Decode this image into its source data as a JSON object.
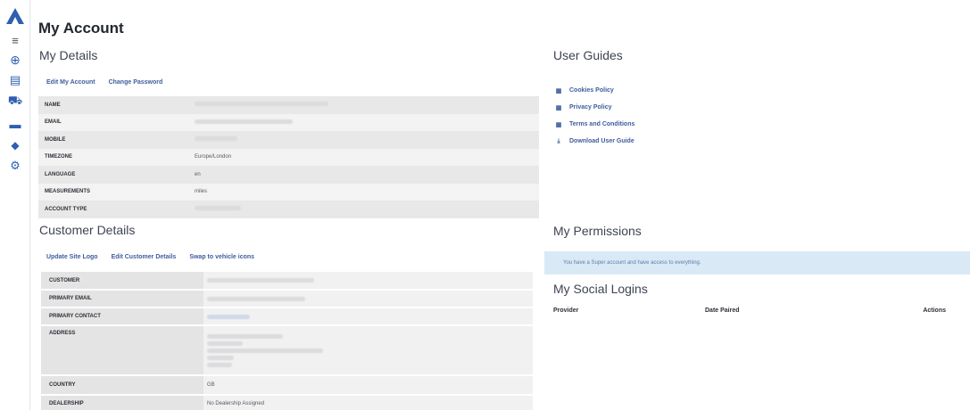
{
  "page": {
    "title": "My Account"
  },
  "sidebar": {
    "items": [
      {
        "icon": "menu-icon",
        "glyph": "≡"
      },
      {
        "icon": "globe-icon",
        "glyph": "⊕"
      },
      {
        "icon": "chart-icon",
        "glyph": "▤"
      },
      {
        "icon": "vehicle-icon",
        "glyph": "⛟"
      },
      {
        "icon": "card-icon",
        "glyph": "▬"
      },
      {
        "icon": "chat-icon",
        "glyph": "◆"
      },
      {
        "icon": "settings-icon",
        "glyph": "⚙"
      }
    ]
  },
  "my_details": {
    "title": "My Details",
    "links": [
      "Edit My Account",
      "Change Password"
    ],
    "rows": [
      {
        "label": "NAME",
        "value": ""
      },
      {
        "label": "EMAIL",
        "value": ""
      },
      {
        "label": "MOBILE",
        "value": ""
      },
      {
        "label": "TIMEZONE",
        "value": "Europe/London"
      },
      {
        "label": "LANGUAGE",
        "value": "en"
      },
      {
        "label": "MEASUREMENTS",
        "value": "miles"
      },
      {
        "label": "ACCOUNT TYPE",
        "value": ""
      }
    ]
  },
  "customer_details": {
    "title": "Customer Details",
    "links": [
      "Update Site Logo",
      "Edit Customer Details",
      "Swap to vehicle icons"
    ],
    "rows": [
      {
        "label": "CUSTOMER",
        "value": ""
      },
      {
        "label": "PRIMARY EMAIL",
        "value": ""
      },
      {
        "label": "PRIMARY CONTACT",
        "value": ""
      },
      {
        "label": "ADDRESS",
        "value": ""
      },
      {
        "label": "COUNTRY",
        "value": "GB"
      },
      {
        "label": "DEALERSHIP",
        "value": "No Dealership Assigned"
      }
    ]
  },
  "user_guides": {
    "title": "User Guides",
    "items": [
      {
        "label": "Cookies Policy",
        "icon": "document-icon"
      },
      {
        "label": "Privacy Policy",
        "icon": "document-icon"
      },
      {
        "label": "Terms and Conditions",
        "icon": "document-icon"
      },
      {
        "label": "Download User Guide",
        "icon": "download-icon"
      }
    ]
  },
  "permissions": {
    "title": "My Permissions",
    "message": "You have a Super account and have access to everything."
  },
  "social_logins": {
    "title": "My Social Logins",
    "columns": [
      "Provider",
      "Date Paired",
      "Actions"
    ]
  },
  "colors": {
    "link": "#3f5d9d",
    "logo": "#2f5fb0",
    "alert_bg": "#d9eaf6"
  }
}
